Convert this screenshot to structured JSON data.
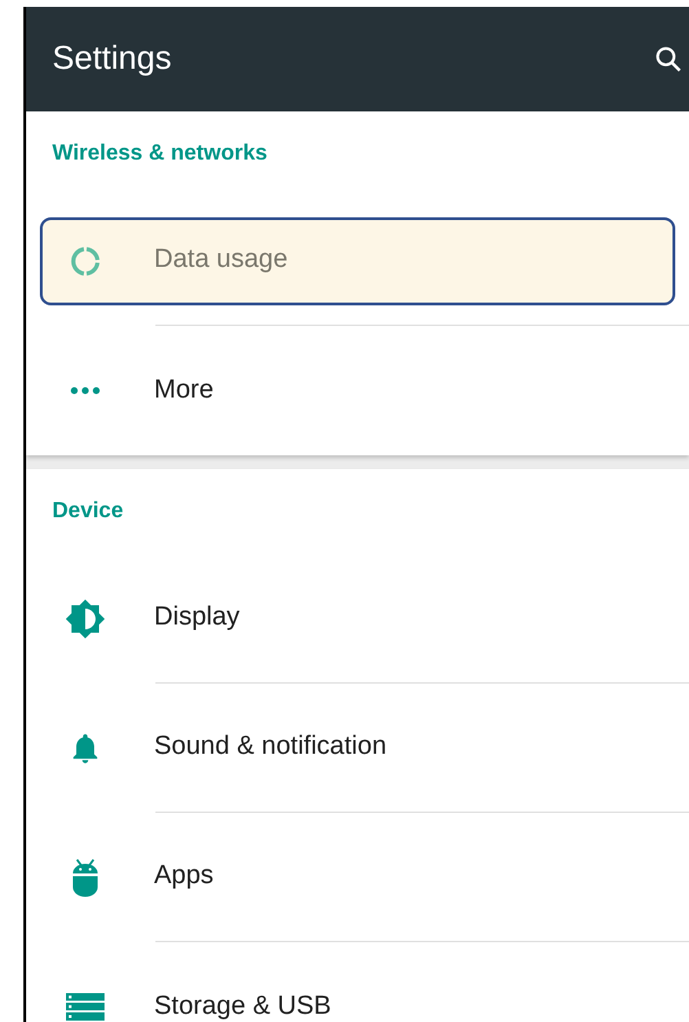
{
  "app_bar": {
    "title": "Settings"
  },
  "sections": [
    {
      "title": "Wireless & networks",
      "items": [
        {
          "label": "Data usage",
          "kind": "data",
          "focused": true
        },
        {
          "label": "More",
          "kind": "more",
          "focused": false
        }
      ]
    },
    {
      "title": "Device",
      "items": [
        {
          "label": "Display",
          "kind": "display",
          "focused": false
        },
        {
          "label": "Sound & notification",
          "kind": "sound",
          "focused": false
        },
        {
          "label": "Apps",
          "kind": "apps",
          "focused": false
        },
        {
          "label": "Storage & USB",
          "kind": "storage",
          "focused": false
        }
      ]
    }
  ]
}
